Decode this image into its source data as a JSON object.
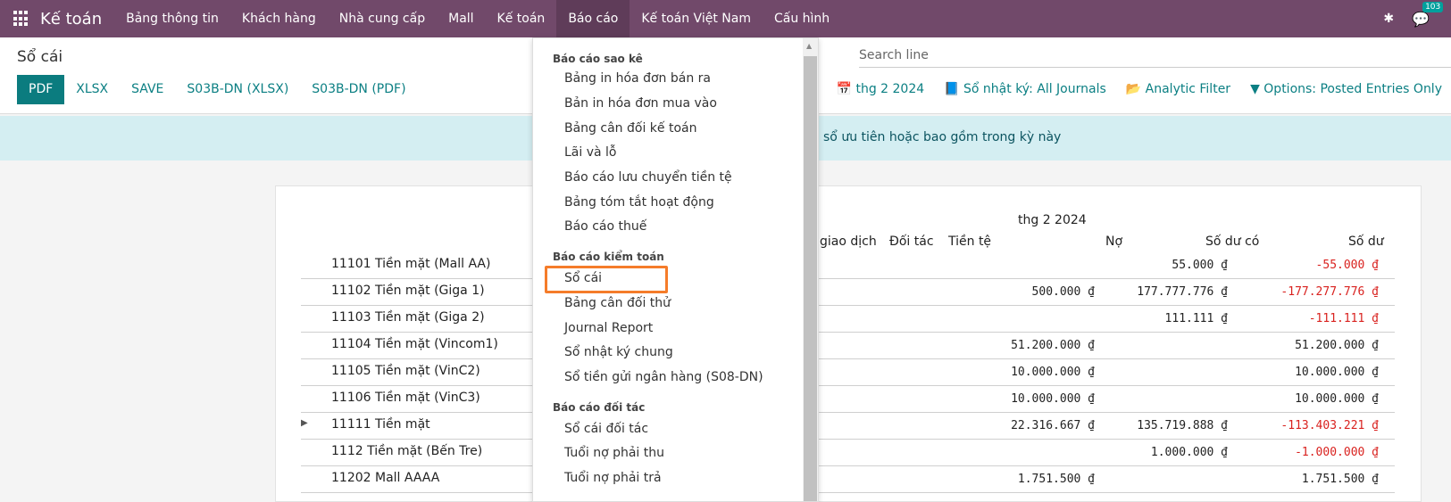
{
  "app": {
    "brand": "Kế toán",
    "notifications": "103"
  },
  "menu": [
    "Bảng thông tin",
    "Khách hàng",
    "Nhà cung cấp",
    "Mall",
    "Kế toán",
    "Báo cáo",
    "Kế toán Việt Nam",
    "Cấu hình"
  ],
  "page": {
    "title": "Sổ cái"
  },
  "buttons": [
    "PDF",
    "XLSX",
    "SAVE",
    "S03B-DN (XLSX)",
    "S03B-DN (PDF)"
  ],
  "search": {
    "placeholder": "Search line"
  },
  "filters": {
    "date": "thg 2 2024",
    "journal": "Sổ nhật ký: All Journals",
    "analytic": "Analytic Filter",
    "options": "Options: Posted Entries Only"
  },
  "alert": {
    "text": "o sổ ưu tiên hoặc bao gồm trong kỳ này"
  },
  "report": {
    "period": "thg 2 2024",
    "headers": {
      "partial": "giao dịch",
      "partner": "Đối tác",
      "currency": "Tiền tệ",
      "debit": "Nợ",
      "credit": "Số dư có",
      "balance": "Số dư"
    },
    "rows": [
      {
        "account": "11101 Tiền mặt (Mall AA)",
        "debit": "",
        "credit": "55.000 ₫",
        "balance": "-55.000 ₫",
        "negative": true,
        "expandable": false
      },
      {
        "account": "11102 Tiền mặt (Giga 1)",
        "debit": "500.000 ₫",
        "credit": "177.777.776 ₫",
        "balance": "-177.277.776 ₫",
        "negative": true,
        "expandable": false
      },
      {
        "account": "11103 Tiền mặt (Giga 2)",
        "debit": "",
        "credit": "111.111 ₫",
        "balance": "-111.111 ₫",
        "negative": true,
        "expandable": false
      },
      {
        "account": "11104 Tiền mặt (Vincom1)",
        "debit": "51.200.000 ₫",
        "credit": "",
        "balance": "51.200.000 ₫",
        "negative": false,
        "expandable": false
      },
      {
        "account": "11105 Tiền mặt (VinC2)",
        "debit": "10.000.000 ₫",
        "credit": "",
        "balance": "10.000.000 ₫",
        "negative": false,
        "expandable": false
      },
      {
        "account": "11106 Tiền mặt (VinC3)",
        "debit": "10.000.000 ₫",
        "credit": "",
        "balance": "10.000.000 ₫",
        "negative": false,
        "expandable": false
      },
      {
        "account": "11111 Tiền mặt",
        "debit": "22.316.667 ₫",
        "credit": "135.719.888 ₫",
        "balance": "-113.403.221 ₫",
        "negative": true,
        "expandable": true
      },
      {
        "account": "1112 Tiền mặt (Bến Tre)",
        "debit": "",
        "credit": "1.000.000 ₫",
        "balance": "-1.000.000 ₫",
        "negative": true,
        "expandable": false
      },
      {
        "account": "11202 Mall AAAA",
        "debit": "1.751.500 ₫",
        "credit": "",
        "balance": "1.751.500 ₫",
        "negative": false,
        "expandable": false
      }
    ]
  },
  "dropdown": {
    "sections": [
      {
        "title": "Báo cáo sao kê",
        "items": [
          "Bảng in hóa đơn bán ra",
          "Bản in hóa đơn mua vào",
          "Bảng cân đối kế toán",
          "Lãi và lỗ",
          "Báo cáo lưu chuyển tiền tệ",
          "Bảng tóm tắt hoạt động",
          "Báo cáo thuế"
        ]
      },
      {
        "title": "Báo cáo kiểm toán",
        "items": [
          "Sổ cái",
          "Bảng cân đối thử",
          "Journal Report",
          "Sổ nhật ký chung",
          "Sổ tiền gửi ngân hàng (S08-DN)"
        ]
      },
      {
        "title": "Báo cáo đối tác",
        "items": [
          "Sổ cái đối tác",
          "Tuổi nợ phải thu",
          "Tuổi nợ phải trả"
        ]
      }
    ]
  },
  "colors": {
    "topbar": "#71496a",
    "accent": "#0b7c7f",
    "negative": "#d9221f",
    "highlight": "#f57c2a",
    "alert_bg": "#d4eef2"
  }
}
